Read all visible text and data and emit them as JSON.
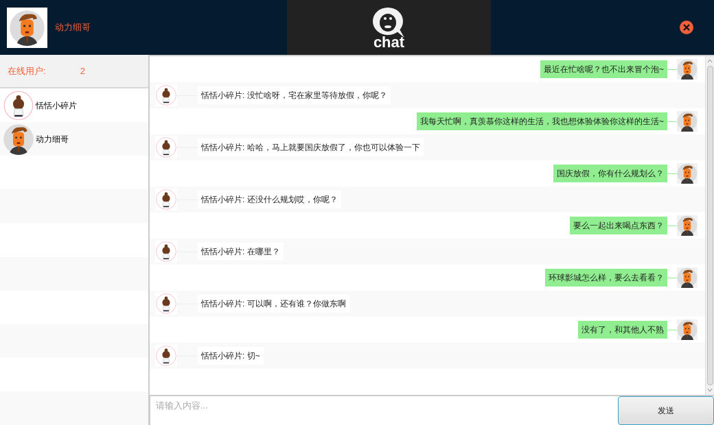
{
  "header": {
    "user_name": "动力细哥",
    "logo_text": "chat"
  },
  "sidebar": {
    "online_label": "在线用户:",
    "online_count": "2",
    "users": [
      {
        "name": "恬恬小碎片",
        "kind": "girl"
      },
      {
        "name": "动力细哥",
        "kind": "man"
      }
    ]
  },
  "messages": [
    {
      "kind": "sent",
      "text": "最近在忙啥呢？也不出来冒个泡~"
    },
    {
      "kind": "received",
      "text": "恬恬小碎片: 没忙啥呀，宅在家里等待放假，你呢？"
    },
    {
      "kind": "sent",
      "text": "我每天忙啊，真羡慕你这样的生活，我也想体验体验你这样的生活~"
    },
    {
      "kind": "received",
      "text": "恬恬小碎片: 哈哈，马上就要国庆放假了，你也可以体验一下"
    },
    {
      "kind": "sent",
      "text": "国庆放假，你有什么规划么？"
    },
    {
      "kind": "received",
      "text": "恬恬小碎片: 还没什么规划哎，你呢？"
    },
    {
      "kind": "sent",
      "text": "要么一起出来喝点东西？"
    },
    {
      "kind": "received",
      "text": "恬恬小碎片: 在哪里？"
    },
    {
      "kind": "sent",
      "text": "环球影城怎么样，要么去看看？"
    },
    {
      "kind": "received",
      "text": "恬恬小碎片: 可以啊，还有谁？你做东啊"
    },
    {
      "kind": "sent",
      "text": "没有了，和其他人不熟"
    },
    {
      "kind": "received",
      "text": "恬恬小碎片: 切~"
    }
  ],
  "composer": {
    "placeholder": "请输入内容...",
    "send_label": "发送"
  }
}
